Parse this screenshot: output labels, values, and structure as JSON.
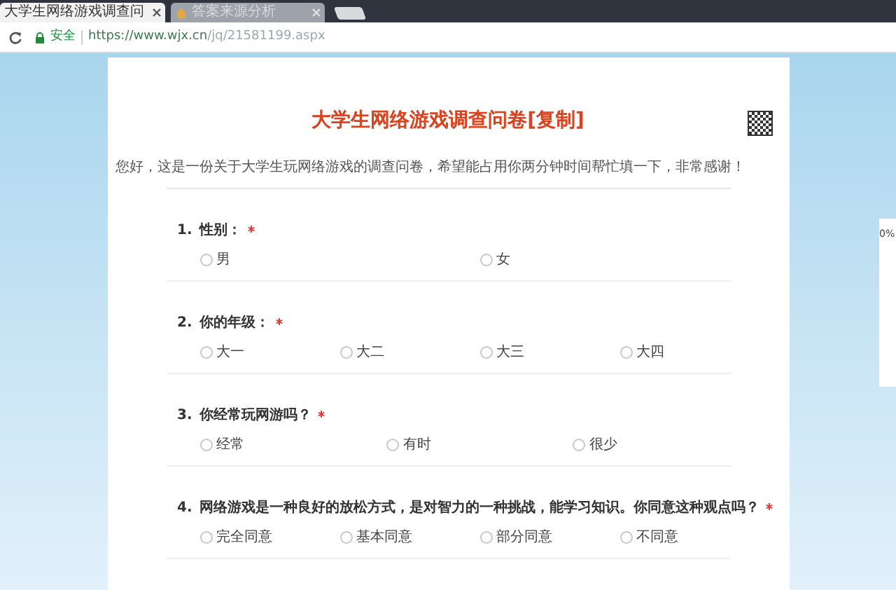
{
  "browser": {
    "tabs": [
      {
        "label": "大学生网络游戏调查问",
        "selected": true
      },
      {
        "label": "答案来源分析",
        "selected": false
      }
    ],
    "secure_label": "安全",
    "url_host": "https://www.wjx.cn",
    "url_path": "/jq/21581199.aspx"
  },
  "survey": {
    "title": "大学生网络游戏调查问卷[复制]",
    "intro": "您好，这是一份关于大学生玩网络游戏的调查问卷，希望能占用你两分钟时间帮忙填一下，非常感谢！",
    "questions": [
      {
        "number": "1.",
        "text": "性别：",
        "required": true,
        "options": [
          {
            "label": "男",
            "selected": false
          },
          {
            "label": "女",
            "selected": false
          }
        ]
      },
      {
        "number": "2.",
        "text": "你的年级：",
        "required": true,
        "options": [
          {
            "label": "大一",
            "selected": false
          },
          {
            "label": "大二",
            "selected": false
          },
          {
            "label": "大三",
            "selected": false
          },
          {
            "label": "大四",
            "selected": false
          }
        ]
      },
      {
        "number": "3.",
        "text": "你经常玩网游吗？",
        "required": true,
        "options": [
          {
            "label": "经常",
            "selected": false
          },
          {
            "label": "有时",
            "selected": false
          },
          {
            "label": "很少",
            "selected": false
          }
        ]
      },
      {
        "number": "4.",
        "text": "网络游戏是一种良好的放松方式，是对智力的一种挑战，能学习知识。你同意这种观点吗？",
        "required": true,
        "options": [
          {
            "label": "完全同意",
            "selected": false
          },
          {
            "label": "基本同意",
            "selected": false
          },
          {
            "label": "部分同意",
            "selected": false
          },
          {
            "label": "不同意",
            "selected": false
          }
        ]
      }
    ]
  },
  "progress": {
    "label": "0%"
  }
}
